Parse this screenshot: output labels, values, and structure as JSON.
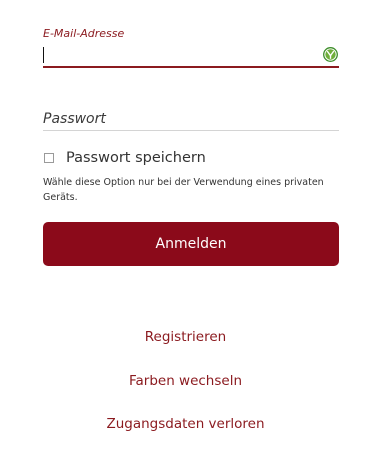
{
  "form": {
    "email_label": "E-Mail-Adresse",
    "email_value": "",
    "password_placeholder": "Passwort",
    "remember_label": "Passwort speichern",
    "remember_hint": "Wähle diese Option nur bei der Verwendung eines privaten Geräts.",
    "login_button": "Anmelden"
  },
  "links": {
    "register": "Registrieren",
    "change_colors": "Farben wechseln",
    "lost_credentials": "Zugangsdaten verloren"
  },
  "icons": {
    "password_manager": "password-manager-icon"
  },
  "colors": {
    "accent": "#8b0a1a",
    "icon_green": "#3f8f2c"
  }
}
